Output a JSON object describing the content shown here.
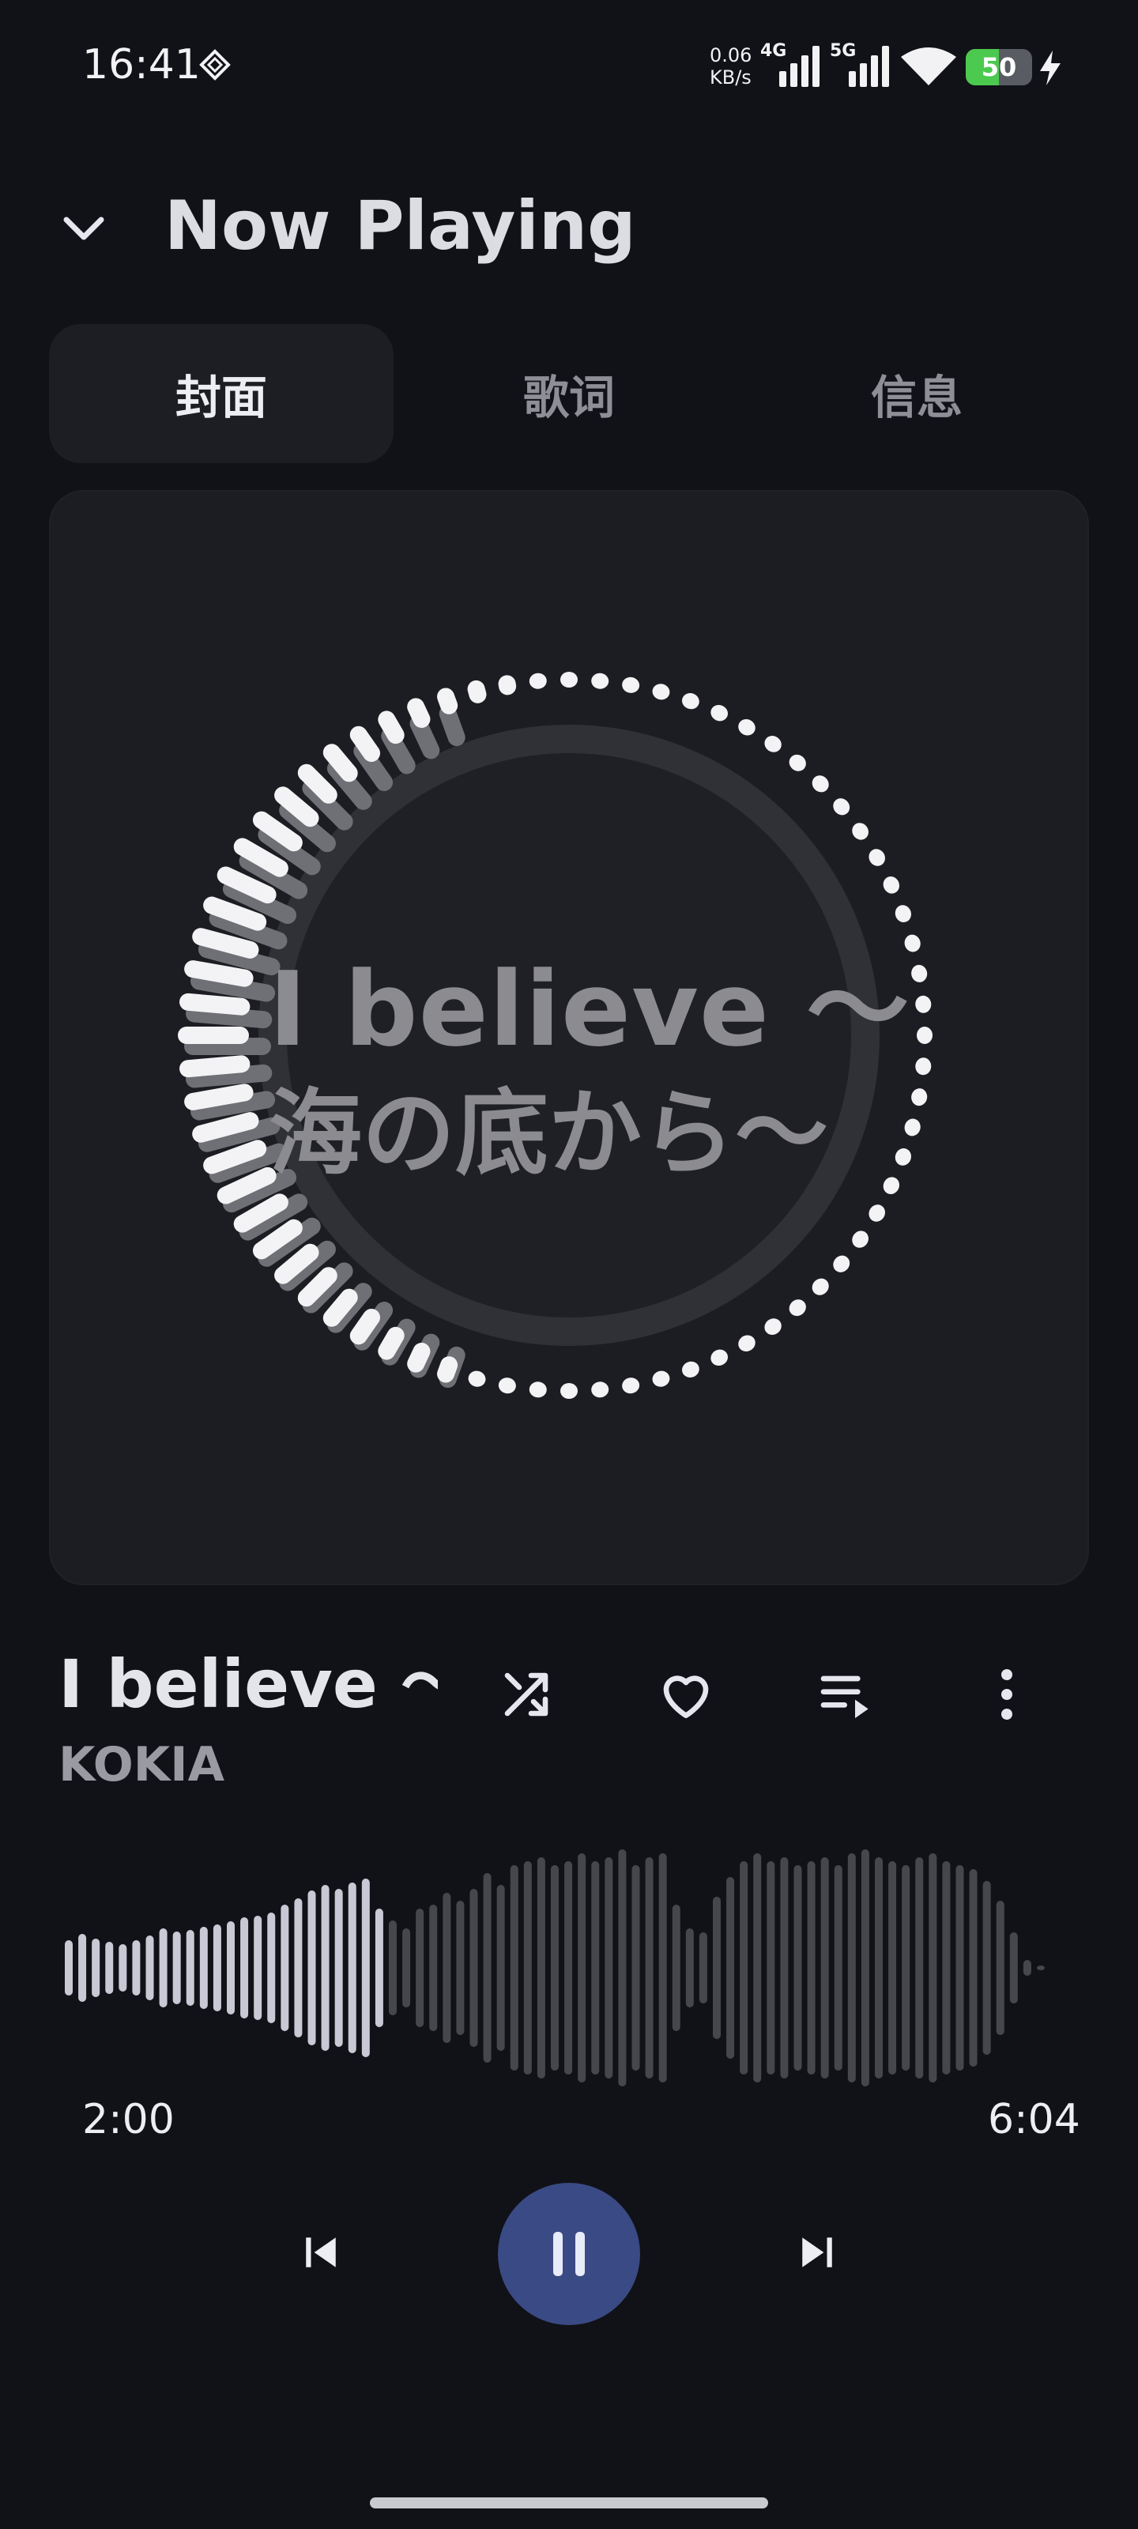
{
  "status_bar": {
    "time": "16:41",
    "net_speed_value": "0.06",
    "net_speed_unit": "KB/s",
    "sim1_label": "4G",
    "sim2_label": "5G",
    "battery_level": "50",
    "battery_fraction": 0.5,
    "icons": [
      "diamond-icon",
      "signal-icon",
      "wifi-icon",
      "battery-icon",
      "charging-bolt-icon"
    ]
  },
  "header": {
    "title": "Now Playing",
    "back_icon": "chevron-down-icon"
  },
  "tabs": [
    {
      "label": "封面",
      "active": true
    },
    {
      "label": "歌词",
      "active": false
    },
    {
      "label": "信息",
      "active": false
    }
  ],
  "cover": {
    "line1": "I believe ～",
    "line2": "海の底から～"
  },
  "track": {
    "title": "I believe ～海の底から～",
    "artist": "KOKIA"
  },
  "actions": {
    "icons": [
      "shuffle-icon",
      "heart-icon",
      "playlist-icon",
      "more-vert-icon"
    ]
  },
  "progress": {
    "elapsed": "2:00",
    "total": "6:04",
    "fraction": 0.33
  },
  "colors": {
    "background": "#111217",
    "card": "#1c1d22",
    "accent": "#3a4a84",
    "waveform_played": "#c8c9d4",
    "waveform_remaining": "#46474d"
  }
}
